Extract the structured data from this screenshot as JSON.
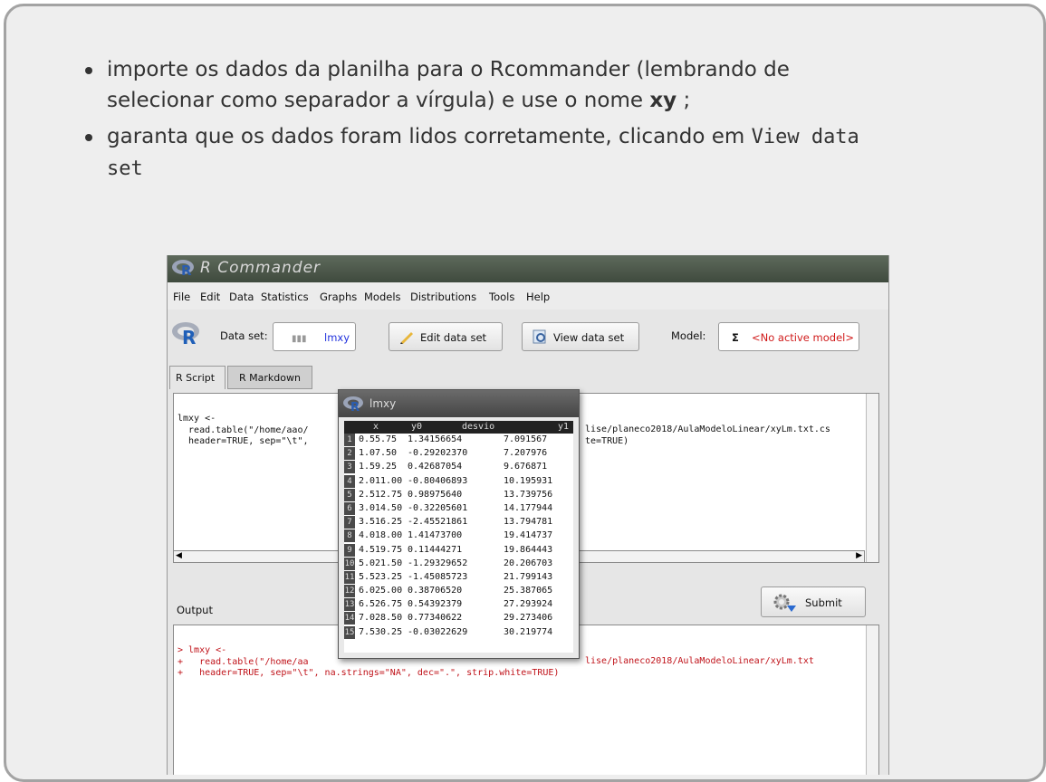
{
  "bullets": [
    {
      "line1": "importe os dados da planilha para o Rcommander (lembrando de",
      "line2a": "selecionar como separador a vírgula) e use o nome ",
      "bold": "xy",
      "line2b": " ;"
    },
    {
      "text": "garanta que os dados foram lidos corretamente, clicando em ",
      "code1": "View data",
      "code2": "set"
    }
  ],
  "window": {
    "title": "R Commander"
  },
  "menu": [
    "File",
    "Edit",
    "Data",
    "Statistics",
    "Graphs",
    "Models",
    "Distributions",
    "Tools",
    "Help"
  ],
  "toolbar": {
    "dataset_label": "Data set:",
    "dataset_value": "lmxy",
    "edit_label": "Edit data set",
    "view_label": "View data set",
    "model_label": "Model:",
    "model_sigma": "Σ",
    "model_value": "<No active model>"
  },
  "tabs": [
    "R Script",
    "R Markdown"
  ],
  "script_lines": [
    "lmxy <-",
    "  read.table(\"/home/aao/",
    "  header=TRUE, sep=\"\\t\","
  ],
  "script_right": [
    "lise/planeco2018/AulaModeloLinear/xyLm.txt.cs",
    "te=TRUE)"
  ],
  "output_label": "Output",
  "submit_label": "Submit",
  "output_lines": [
    "> lmxy <-",
    "+   read.table(\"/home/aa",
    "+   header=TRUE, sep=\"\\t\", na.strings=\"NA\", dec=\".\", strip.white=TRUE)"
  ],
  "output_right": "lise/planeco2018/AulaModeloLinear/xyLm.txt",
  "dataview": {
    "title": "lmxy",
    "columns": [
      "x",
      "y0",
      "desvio",
      "y1"
    ],
    "rows": [
      [
        "1",
        "0.5",
        "5.75",
        "1.34156654",
        "7.091567"
      ],
      [
        "2",
        "1.0",
        "7.50",
        "-0.29202370",
        "7.207976"
      ],
      [
        "3",
        "1.5",
        "9.25",
        "0.42687054",
        "9.676871"
      ],
      [
        "4",
        "2.0",
        "11.00",
        "-0.80406893",
        "10.195931"
      ],
      [
        "5",
        "2.5",
        "12.75",
        "0.98975640",
        "13.739756"
      ],
      [
        "6",
        "3.0",
        "14.50",
        "-0.32205601",
        "14.177944"
      ],
      [
        "7",
        "3.5",
        "16.25",
        "-2.45521861",
        "13.794781"
      ],
      [
        "8",
        "4.0",
        "18.00",
        "1.41473700",
        "19.414737"
      ],
      [
        "9",
        "4.5",
        "19.75",
        "0.11444271",
        "19.864443"
      ],
      [
        "10",
        "5.0",
        "21.50",
        "-1.29329652",
        "20.206703"
      ],
      [
        "11",
        "5.5",
        "23.25",
        "-1.45085723",
        "21.799143"
      ],
      [
        "12",
        "6.0",
        "25.00",
        "0.38706520",
        "25.387065"
      ],
      [
        "13",
        "6.5",
        "26.75",
        "0.54392379",
        "27.293924"
      ],
      [
        "14",
        "7.0",
        "28.50",
        "0.77340622",
        "29.273406"
      ],
      [
        "15",
        "7.5",
        "30.25",
        "-0.03022629",
        "30.219774"
      ]
    ]
  }
}
